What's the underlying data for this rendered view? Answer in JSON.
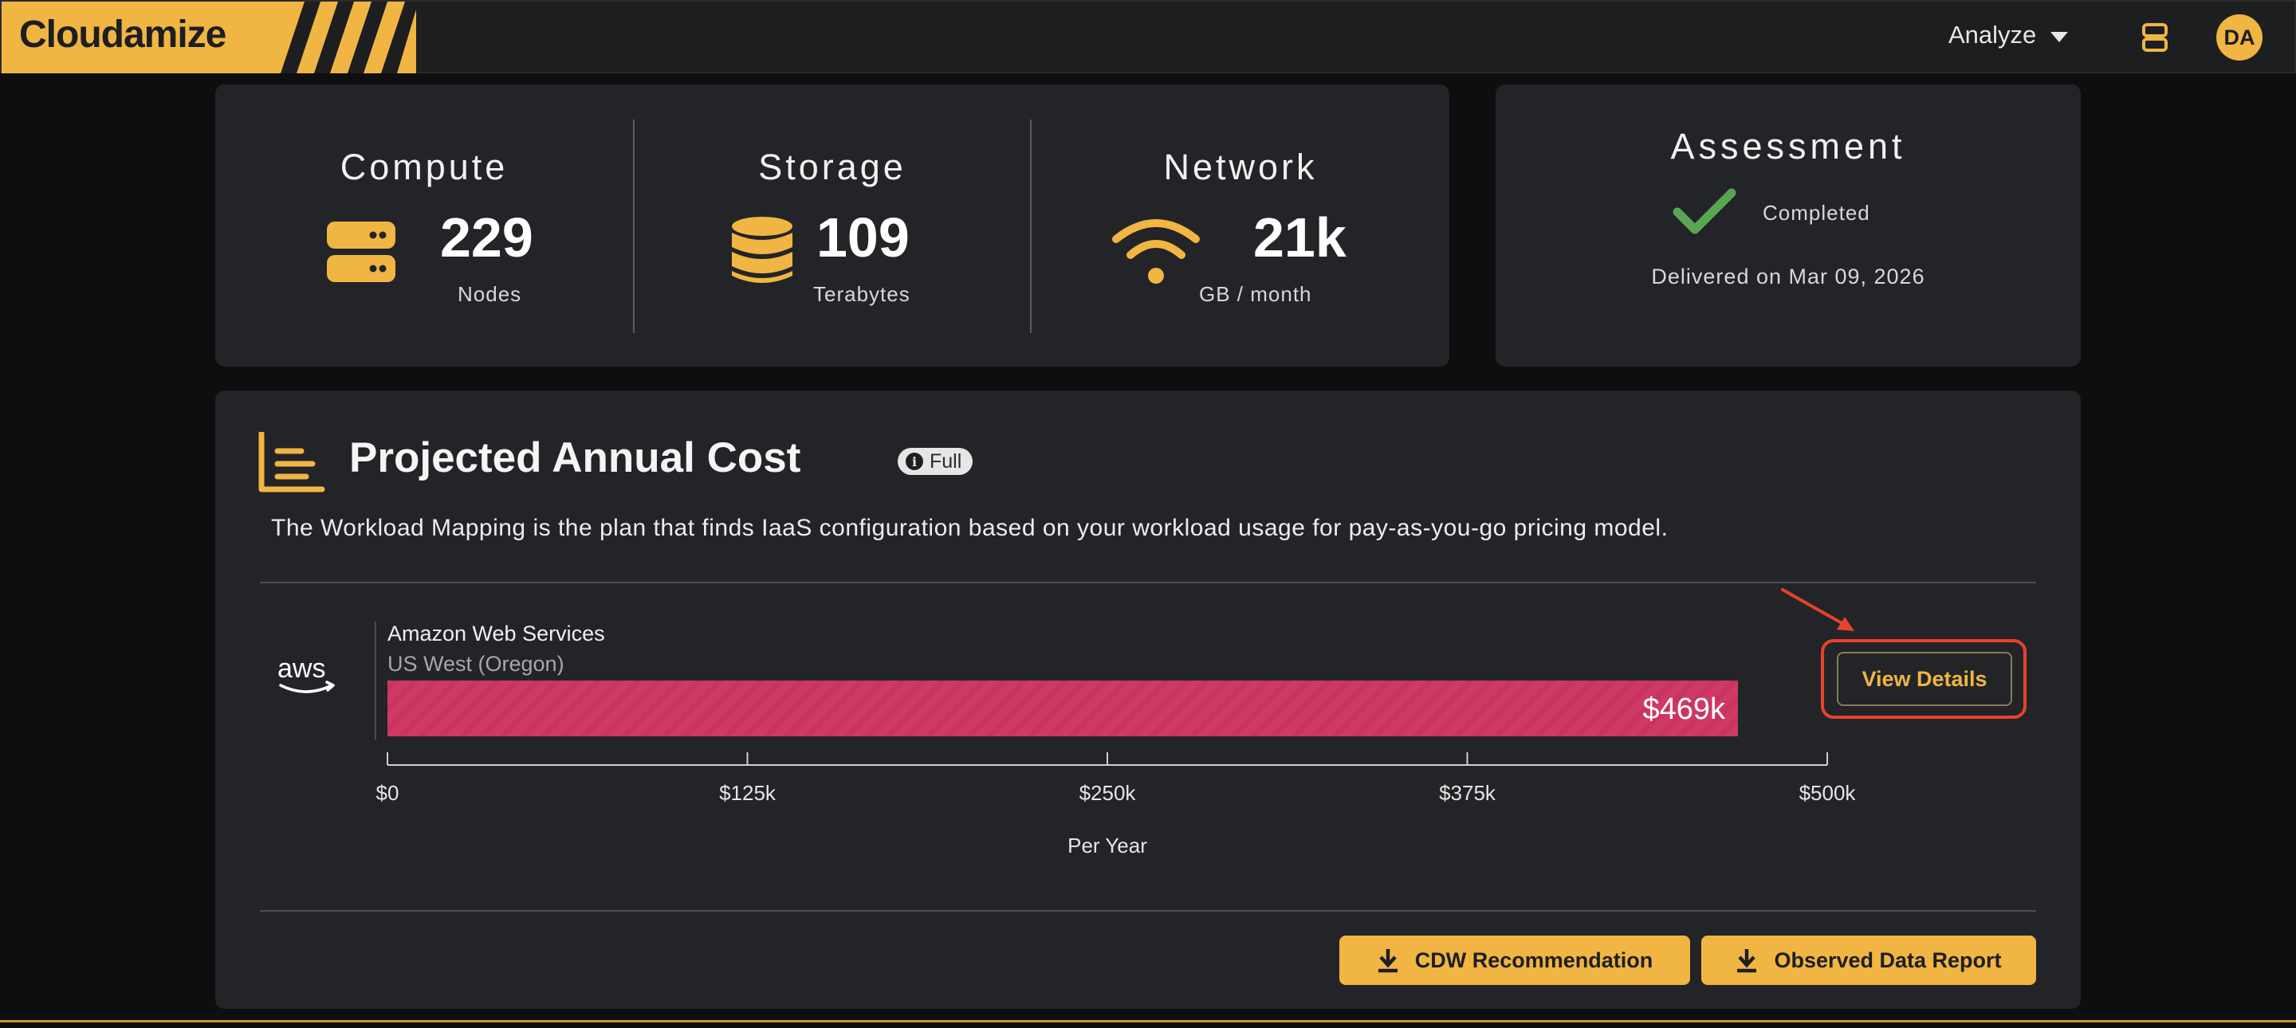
{
  "app": {
    "logo_text": "Cloudamize",
    "nav_menu_label": "Analyze",
    "avatar_initials": "DA",
    "accent_color": "#f0b542"
  },
  "metrics": {
    "compute": {
      "title": "Compute",
      "value": "229",
      "unit": "Nodes",
      "icon": "server-icon"
    },
    "storage": {
      "title": "Storage",
      "value": "109",
      "unit": "Terabytes",
      "icon": "database-icon"
    },
    "network": {
      "title": "Network",
      "value": "21k",
      "unit": "GB / month",
      "icon": "wifi-icon"
    }
  },
  "assessment": {
    "title": "Assessment",
    "status": "Completed",
    "delivered": "Delivered on Mar 09, 2026",
    "status_color": "#5aa552"
  },
  "cost": {
    "title": "Projected Annual Cost",
    "badge": "Full",
    "description": "The Workload Mapping is the plan that finds IaaS configuration based on your workload usage for pay-as-you-go pricing model.",
    "provider_logo": "aws",
    "provider_name": "Amazon Web Services",
    "region": "US West (Oregon)",
    "view_details_label": "View Details",
    "buttons": {
      "cdw": "CDW Recommendation",
      "observed": "Observed Data Report"
    }
  },
  "chart_data": {
    "type": "bar",
    "orientation": "horizontal",
    "categories": [
      "Amazon Web Services"
    ],
    "values": [
      469000
    ],
    "value_labels": [
      "$469k"
    ],
    "xlim": [
      0,
      500000
    ],
    "x_ticks": [
      0,
      125000,
      250000,
      375000,
      500000
    ],
    "x_tick_labels": [
      "$0",
      "$125k",
      "$250k",
      "$375k",
      "$500k"
    ],
    "xlabel": "Per Year",
    "bar_color": "#cf3a64",
    "grid": false
  }
}
